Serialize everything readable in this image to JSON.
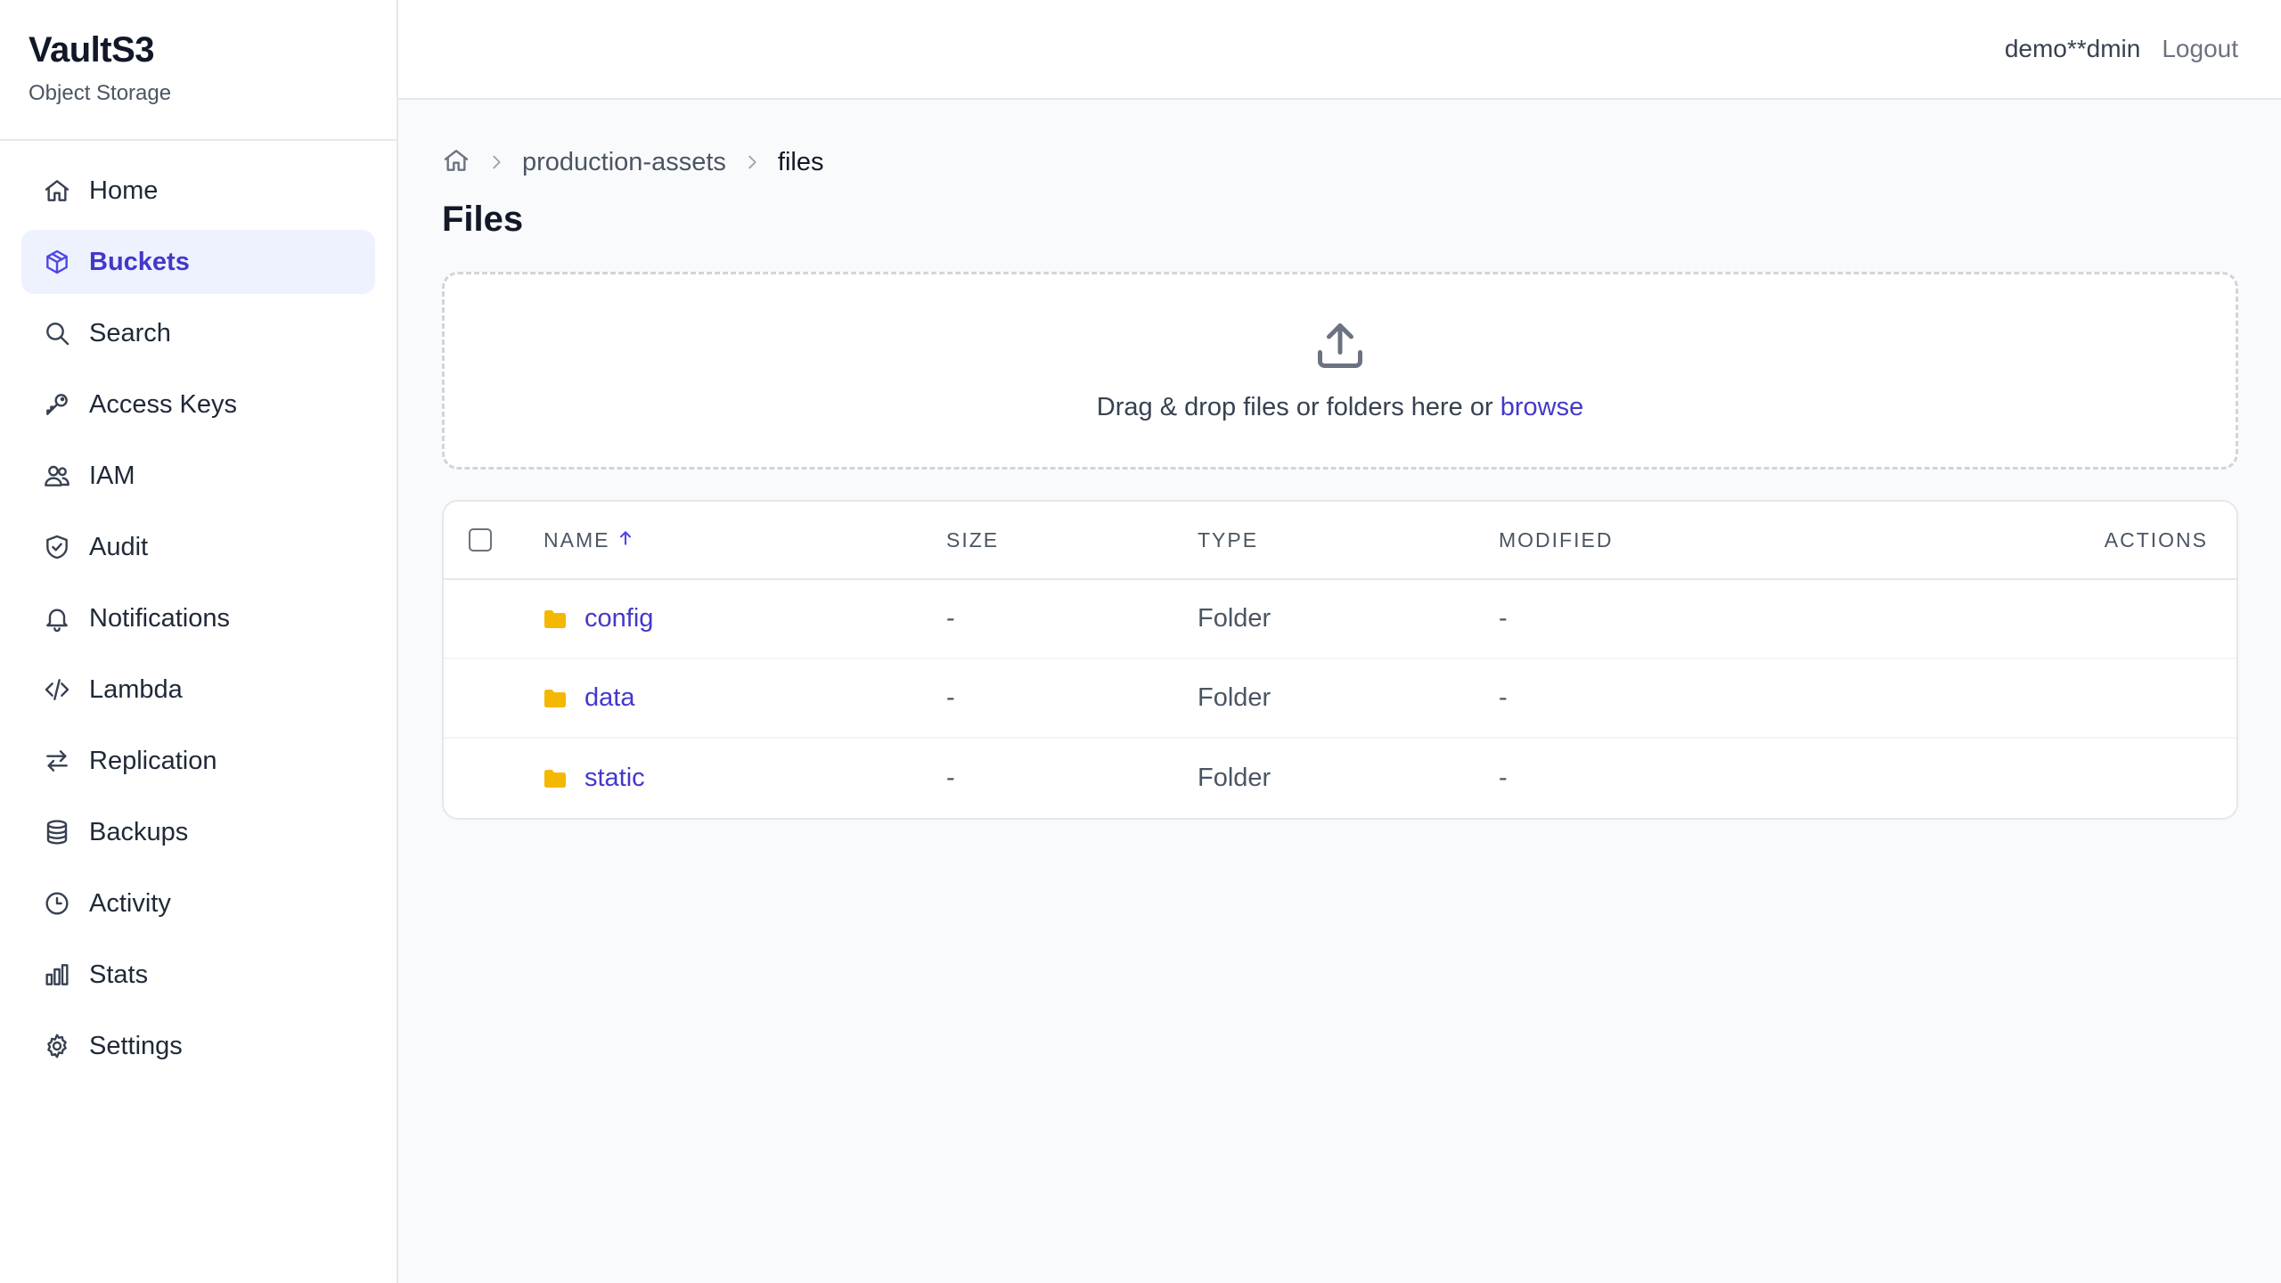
{
  "brand": {
    "name": "VaultS3",
    "subtitle": "Object Storage"
  },
  "sidebar": {
    "items": [
      {
        "label": "Home",
        "icon": "home-icon",
        "active": false
      },
      {
        "label": "Buckets",
        "icon": "cube-icon",
        "active": true
      },
      {
        "label": "Search",
        "icon": "search-icon",
        "active": false
      },
      {
        "label": "Access Keys",
        "icon": "key-icon",
        "active": false
      },
      {
        "label": "IAM",
        "icon": "users-icon",
        "active": false
      },
      {
        "label": "Audit",
        "icon": "shield-check-icon",
        "active": false
      },
      {
        "label": "Notifications",
        "icon": "bell-icon",
        "active": false
      },
      {
        "label": "Lambda",
        "icon": "code-icon",
        "active": false
      },
      {
        "label": "Replication",
        "icon": "arrows-exchange-icon",
        "active": false
      },
      {
        "label": "Backups",
        "icon": "database-icon",
        "active": false
      },
      {
        "label": "Activity",
        "icon": "clock-icon",
        "active": false
      },
      {
        "label": "Stats",
        "icon": "bar-chart-icon",
        "active": false
      },
      {
        "label": "Settings",
        "icon": "gear-icon",
        "active": false
      }
    ]
  },
  "header": {
    "user": "demo**dmin",
    "logout_label": "Logout"
  },
  "breadcrumb": {
    "items": [
      "production-assets",
      "files"
    ]
  },
  "page": {
    "title": "Files"
  },
  "dropzone": {
    "text": "Drag & drop files or folders here or",
    "browse_label": "browse"
  },
  "table": {
    "columns": {
      "name": "NAME",
      "size": "SIZE",
      "type": "TYPE",
      "modified": "MODIFIED",
      "actions": "ACTIONS"
    },
    "sort": {
      "column": "name",
      "direction": "asc"
    },
    "rows": [
      {
        "name": "config",
        "size": "-",
        "type": "Folder",
        "modified": "-"
      },
      {
        "name": "data",
        "size": "-",
        "type": "Folder",
        "modified": "-"
      },
      {
        "name": "static",
        "size": "-",
        "type": "Folder",
        "modified": "-"
      }
    ]
  },
  "colors": {
    "accent": "#4f46e5",
    "accent_bg": "#eef2ff",
    "folder": "#f5b800"
  }
}
